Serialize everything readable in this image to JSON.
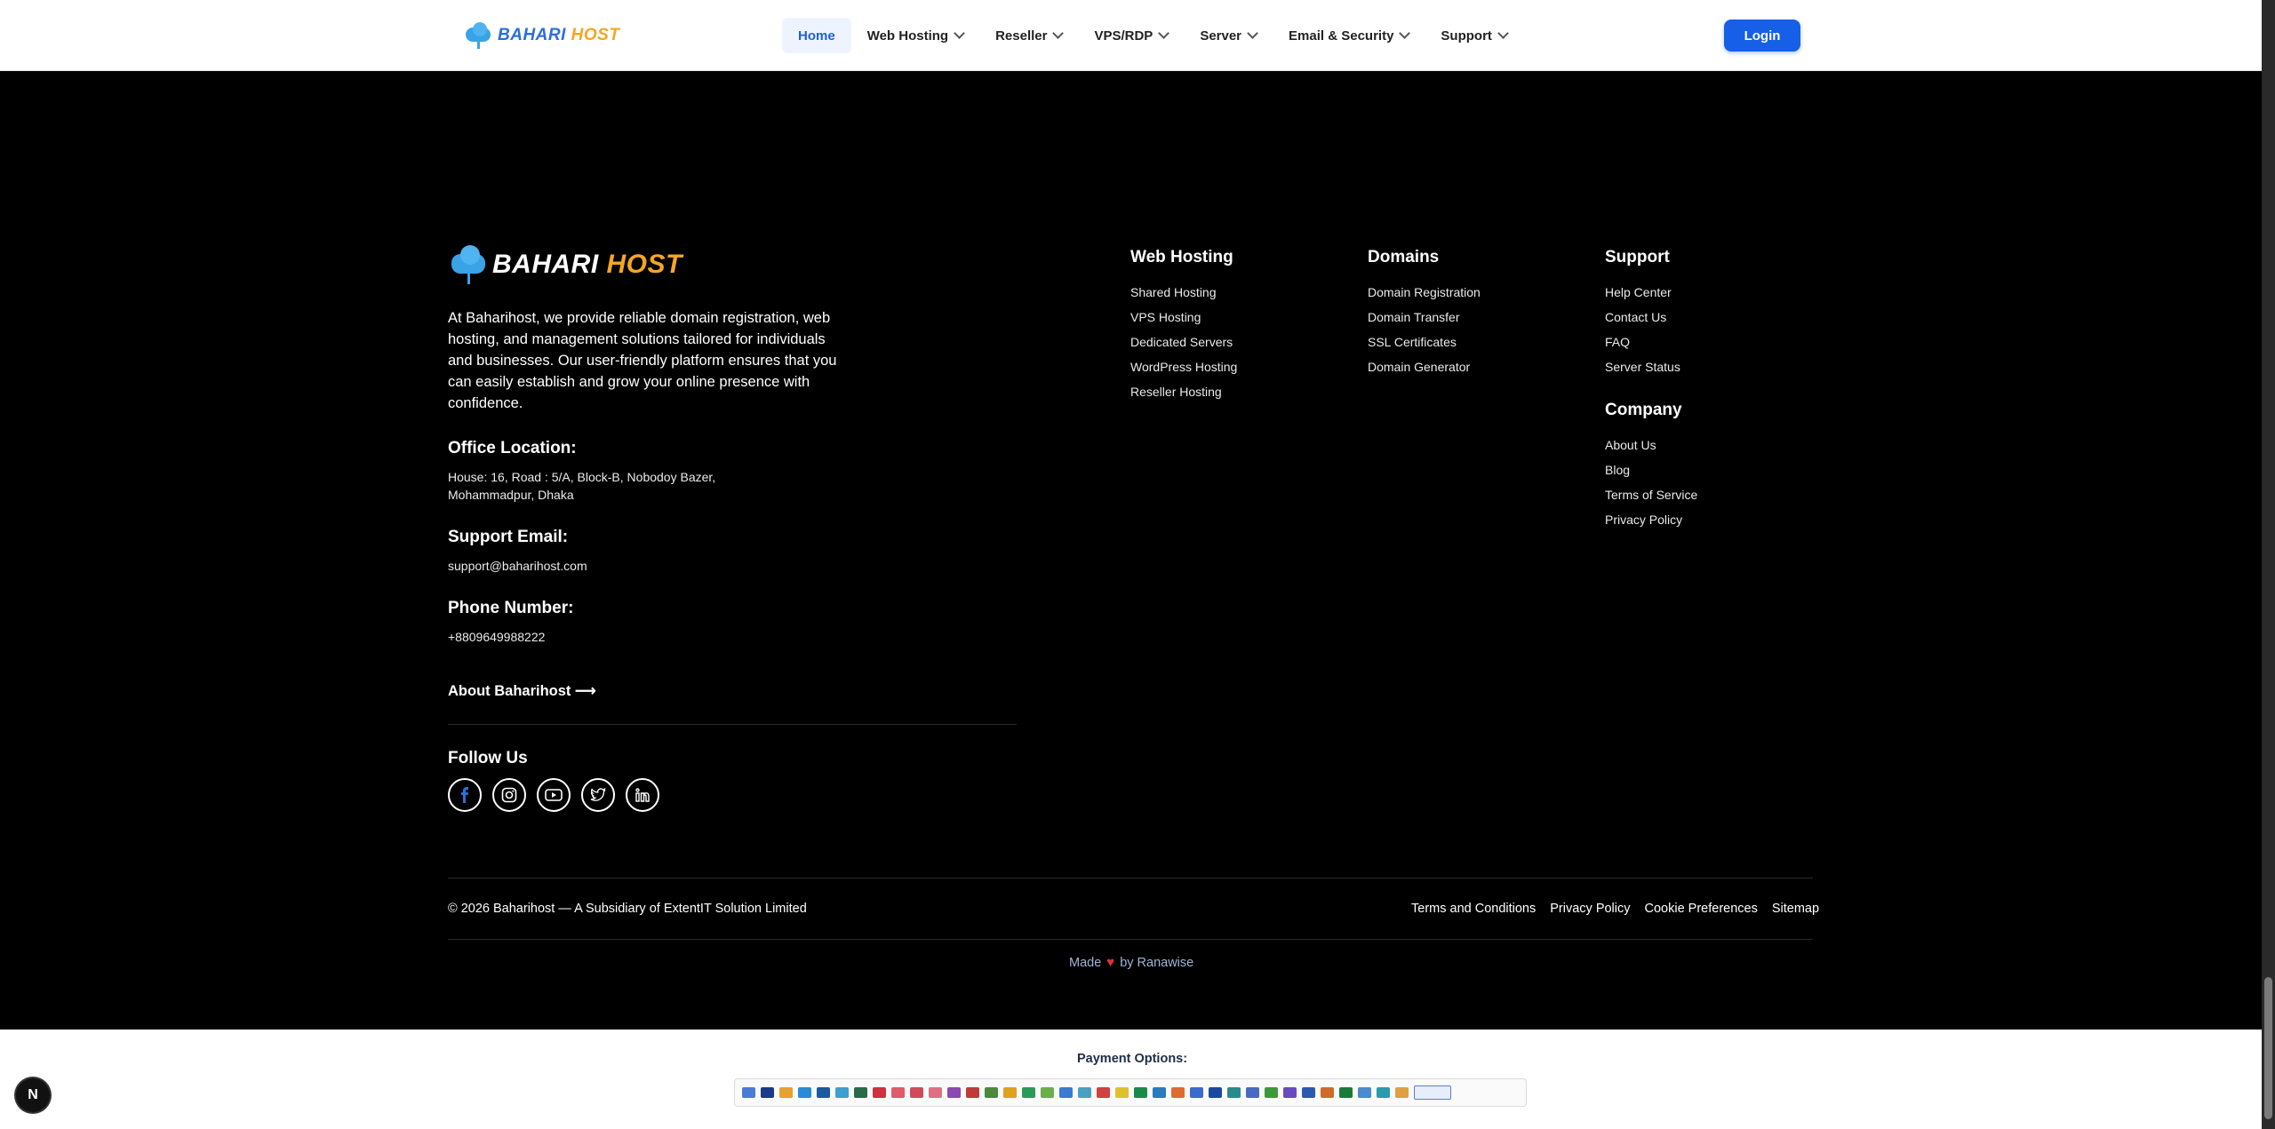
{
  "header": {
    "logo_part1": "BAHARI",
    "logo_part2": "HOST",
    "nav": [
      {
        "label": "Home"
      },
      {
        "label": "Web Hosting"
      },
      {
        "label": "Reseller"
      },
      {
        "label": "VPS/RDP"
      },
      {
        "label": "Server"
      },
      {
        "label": "Email & Security"
      },
      {
        "label": "Support"
      }
    ],
    "login_label": "Login"
  },
  "footer": {
    "brand_part1": "BAHARI",
    "brand_part2": "HOST",
    "about_text": "At Baharihost, we provide reliable domain registration, web hosting, and management solutions tailored for individuals and businesses. Our user-friendly platform ensures that you can easily establish and grow your online presence with confidence.",
    "office_label": "Office Location:",
    "office_address_line1": "House: 16, Road : 5/A, Block-B, Nobodoy Bazer,",
    "office_address_line2": "Mohammadpur, Dhaka",
    "email_label": "Support Email:",
    "email_value": "support@baharihost.com",
    "phone_label": "Phone Number:",
    "phone_value": "+8809649988222",
    "about_link": "About Baharihost ⟶",
    "follow_label": "Follow Us",
    "socials": [
      "facebook-icon",
      "instagram-icon",
      "youtube-icon",
      "twitter-icon",
      "linkedin-icon"
    ],
    "columns": {
      "web_hosting": {
        "title": "Web Hosting",
        "links": [
          "Shared Hosting",
          "VPS Hosting",
          "Dedicated Servers",
          "WordPress Hosting",
          "Reseller Hosting"
        ]
      },
      "domains": {
        "title": "Domains",
        "links": [
          "Domain Registration",
          "Domain Transfer",
          "SSL Certificates",
          "Domain Generator"
        ]
      },
      "support": {
        "title": "Support",
        "links": [
          "Help Center",
          "Contact Us",
          "FAQ",
          "Server Status"
        ]
      },
      "company": {
        "title": "Company",
        "links": [
          "About Us",
          "Blog",
          "Terms of Service",
          "Privacy Policy"
        ]
      }
    },
    "copyright": "© 2026 Baharihost — A Subsidiary of ExtentIT Solution Limited",
    "legal_links": [
      "Terms and Conditions",
      "Privacy Policy",
      "Cookie Preferences",
      "Sitemap"
    ],
    "made_prefix": "Made",
    "made_suffix": "by Ranawise"
  },
  "payment": {
    "title": "Payment Options:"
  },
  "colors": {
    "accent": "#1660e8",
    "footer_bg": "#000000",
    "logo_orange": "#f5a623"
  }
}
